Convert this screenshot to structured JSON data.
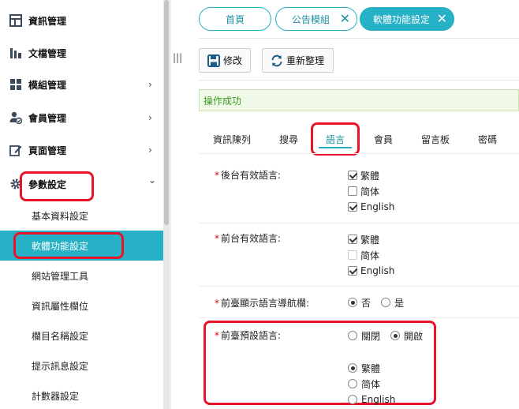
{
  "sidebar": {
    "menu": [
      {
        "label": "資訊管理",
        "icon": "grid-icon",
        "arrow": ""
      },
      {
        "label": "文檔管理",
        "icon": "bar-chart-icon",
        "arrow": ""
      },
      {
        "label": "模組管理",
        "icon": "apps-icon",
        "arrow": "›"
      },
      {
        "label": "會員管理",
        "icon": "user-check-icon",
        "arrow": "›"
      },
      {
        "label": "頁面管理",
        "icon": "edit-icon",
        "arrow": "›"
      },
      {
        "label": "參數設定",
        "icon": "gear-icon",
        "arrow": "⌄"
      }
    ],
    "submenu": [
      {
        "label": "基本資料設定"
      },
      {
        "label": "軟體功能設定"
      },
      {
        "label": "網站管理工具"
      },
      {
        "label": "資訊屬性欄位"
      },
      {
        "label": "欄目名稱設定"
      },
      {
        "label": "提示訊息設定"
      },
      {
        "label": "計數器設定"
      }
    ],
    "collapse_glyph": "|||"
  },
  "tabs": [
    {
      "label": "首頁",
      "close": ""
    },
    {
      "label": "公告模組",
      "close": "✕"
    },
    {
      "label": "軟體功能設定",
      "close": "✕"
    }
  ],
  "toolbar": {
    "edit_label": "修改",
    "refresh_label": "重新整理"
  },
  "message": "操作成功",
  "subtabs": [
    "資訊陳列",
    "搜尋",
    "語言",
    "會員",
    "留言板",
    "密碼"
  ],
  "form": {
    "backend_lang": {
      "label": "後台有效語言:",
      "options": [
        {
          "label": "繁體",
          "checked": true
        },
        {
          "label": "简体",
          "checked": false
        },
        {
          "label": "English",
          "checked": true
        }
      ]
    },
    "frontend_lang": {
      "label": "前台有效語言:",
      "options": [
        {
          "label": "繁體",
          "checked": true
        },
        {
          "label": "简体",
          "checked": false
        },
        {
          "label": "English",
          "checked": true
        }
      ]
    },
    "nav_bar": {
      "label": "前臺顯示語言導航欄:",
      "options": [
        {
          "label": "否",
          "checked": true
        },
        {
          "label": "是",
          "checked": false
        }
      ]
    },
    "default_lang": {
      "label": "前臺預設語言:",
      "toggle": [
        {
          "label": "關閉",
          "checked": false
        },
        {
          "label": "開啟",
          "checked": true
        }
      ],
      "options": [
        {
          "label": "繁體",
          "checked": true
        },
        {
          "label": "简体",
          "checked": false
        },
        {
          "label": "English",
          "checked": false
        }
      ]
    }
  },
  "colors": {
    "accent": "#27b1c6",
    "highlight": "#e8142c",
    "success_text": "#3b9a21"
  }
}
